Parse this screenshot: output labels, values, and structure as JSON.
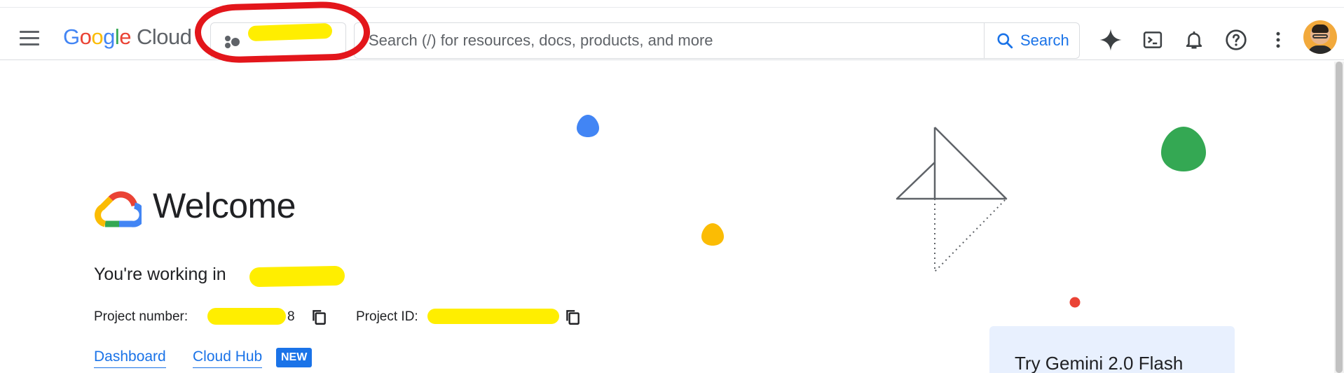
{
  "topbar": {
    "logo_google": "Google",
    "logo_cloud": "Cloud",
    "project_picker_label": "",
    "search": {
      "placeholder": "Search (/) for resources, docs, products, and more",
      "button_label": "Search"
    },
    "icons": [
      "menu-icon",
      "project-dots-icon",
      "search-icon",
      "gemini-sparkle-icon",
      "cloud-shell-terminal-icon",
      "notifications-bell-icon",
      "help-icon",
      "more-vert-icon",
      "avatar"
    ]
  },
  "welcome": {
    "title": "Welcome",
    "working_in_label": "You're working in",
    "project_name": "",
    "project_number_label": "Project number:",
    "project_number_value": "8",
    "project_id_label": "Project ID:",
    "project_id_value": ""
  },
  "links": {
    "dashboard": "Dashboard",
    "cloud_hub": "Cloud Hub",
    "new_badge": "NEW"
  },
  "promo": {
    "gemini_card_title": "Try Gemini 2.0 Flash"
  },
  "colors": {
    "accent": "#1a73e8",
    "blob_blue": "#4285f4",
    "blob_yellow": "#fbbc04",
    "blob_green": "#34a853",
    "blob_red": "#ea4335",
    "annotation_red": "#e3161b",
    "redaction_yellow": "#ffee00"
  }
}
